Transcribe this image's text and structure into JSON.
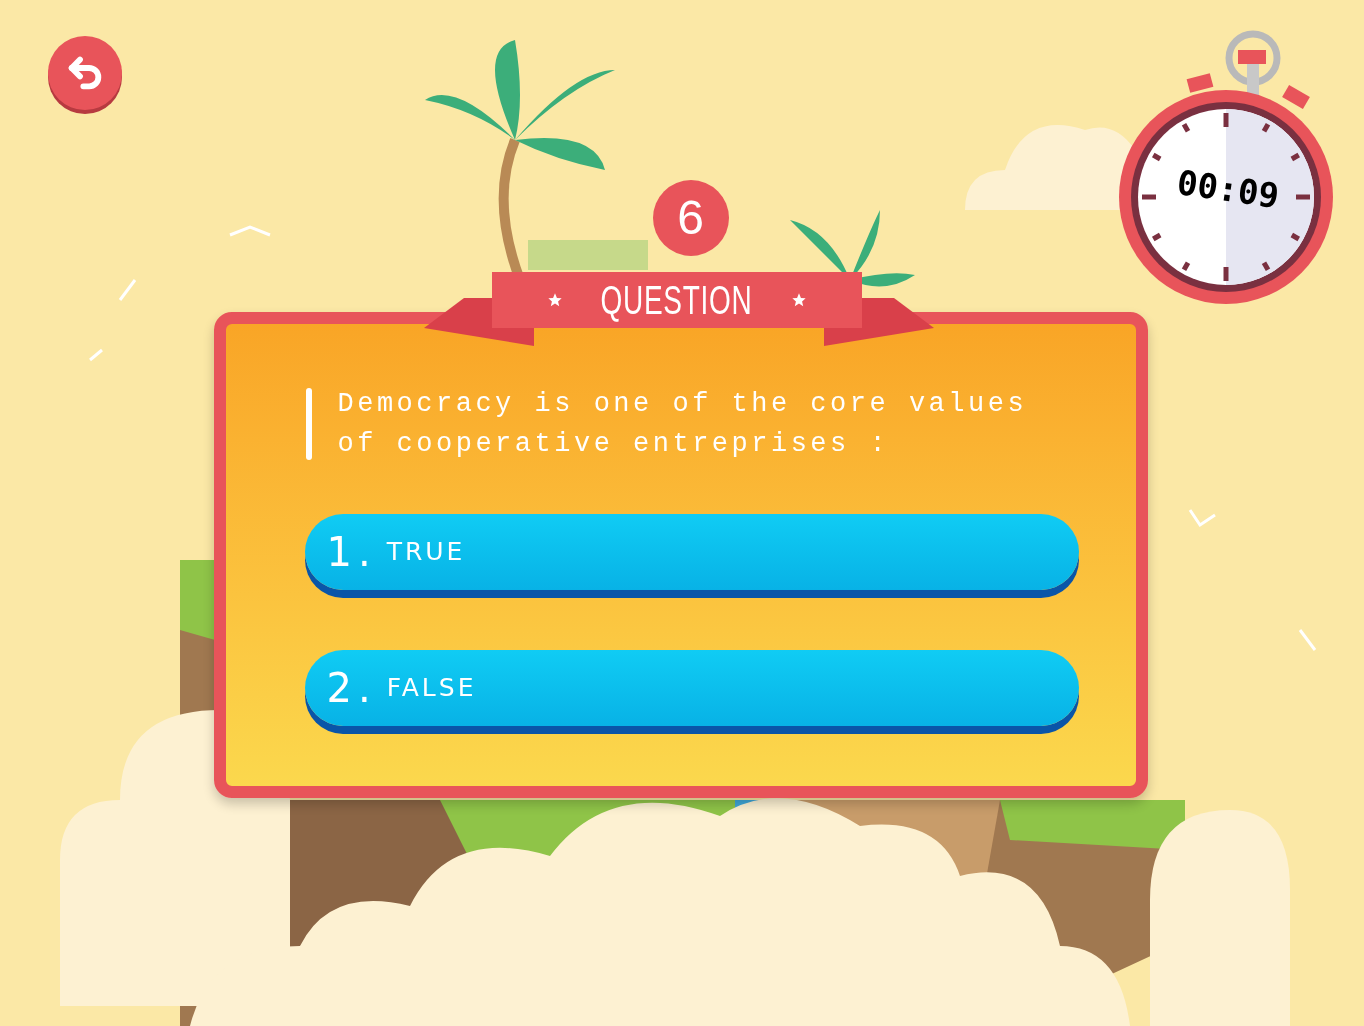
{
  "question_number": "6",
  "banner": "QUESTION",
  "timer": "00:09",
  "question": "Democracy is one of the core values of cooperative entreprises :",
  "answers": [
    {
      "number": "1.",
      "label": "TRUE"
    },
    {
      "number": "2.",
      "label": "FALSE"
    }
  ]
}
